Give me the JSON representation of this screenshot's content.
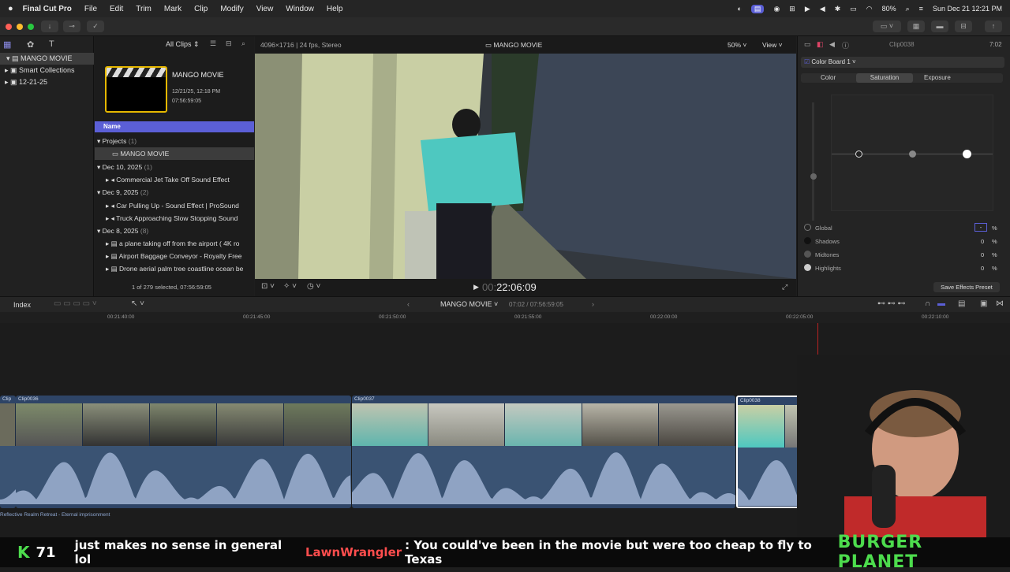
{
  "menubar": {
    "app": "Final Cut Pro",
    "items": [
      "File",
      "Edit",
      "Trim",
      "Mark",
      "Clip",
      "Modify",
      "View",
      "Window",
      "Help"
    ],
    "battery": "80%",
    "datetime": "Sun Dec 21  12:21 PM"
  },
  "sidebar": {
    "library": "MANGO MOVIE",
    "smart_collections": "Smart Collections",
    "event": "12-21-25"
  },
  "browser": {
    "filter": "All Clips",
    "project_card": {
      "title": "MANGO MOVIE",
      "date": "12/21/25, 12:18 PM",
      "duration": "07:56:59:05"
    },
    "column_header": "Name",
    "groups": [
      {
        "label": "Projects",
        "count": "(1)"
      },
      {
        "label": "Dec 10, 2025",
        "count": "(1)"
      },
      {
        "label": "Dec 9, 2025",
        "count": "(2)"
      },
      {
        "label": "Dec 8, 2025",
        "count": "(8)"
      }
    ],
    "items": [
      "MANGO MOVIE",
      "Commercial Jet Take Off Sound Effect",
      "Car Pulling Up - Sound Effect  |  ProSound",
      "Truck Approaching Slow Stopping Sound",
      "a plane taking off from the airport ( 4K ro",
      "Airport Baggage Conveyor - Royalty Free",
      "Drone aerial palm tree coastline ocean be"
    ],
    "status": "1 of 279 selected, 07:56:59:05"
  },
  "viewer": {
    "format": "4096×1716 | 24 fps, Stereo",
    "title": "MANGO MOVIE",
    "zoom": "50%",
    "view_label": "View",
    "timecode_dim": "00:",
    "timecode": "22:06:09"
  },
  "inspector": {
    "clip_name": "Clip0038",
    "clip_duration": "7:02",
    "effect": "Color Board 1",
    "tabs": [
      "Color",
      "Saturation",
      "Exposure"
    ],
    "active_tab": "Saturation",
    "params": [
      {
        "label": "Global",
        "value": "-",
        "unit": "%"
      },
      {
        "label": "Shadows",
        "value": "0",
        "unit": "%"
      },
      {
        "label": "Midtones",
        "value": "0",
        "unit": "%"
      },
      {
        "label": "Highlights",
        "value": "0",
        "unit": "%"
      }
    ],
    "save_button": "Save Effects Preset"
  },
  "timeline": {
    "index_label": "Index",
    "project": "MANGO MOVIE",
    "position": "07:02 / 07:56:59:05",
    "ruler": [
      "00:21:40:00",
      "00:21:45:00",
      "00:21:50:00",
      "00:21:55:00",
      "00:22:00:00",
      "00:22:05:00",
      "00:22:10:00"
    ],
    "clips": [
      "Clip",
      "Clip0036",
      "Clip0037",
      "Clip0038"
    ],
    "audio_label": "Reflective Realm Retreat - Eternal imprisonment"
  },
  "ticker": {
    "k_badge": "K",
    "k_count": "71",
    "msg1": "just makes no sense in general lol",
    "user": "LawnWrangler",
    "msg2": ": You could've been in the movie but were too cheap to fly to Texas",
    "brand": "BURGER PLANET"
  },
  "colors": {
    "accent": "#5b5fd6",
    "selection": "#3c3c3c",
    "clip": "#2e4466",
    "ticker_green": "#4ddc4d",
    "user_red": "#ff4d4d"
  }
}
